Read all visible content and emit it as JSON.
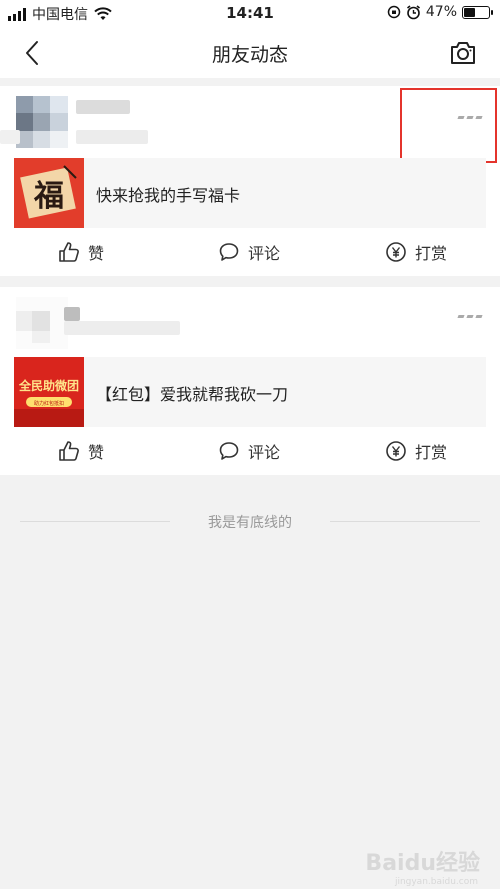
{
  "status_bar": {
    "carrier": "中国电信",
    "time": "14:41",
    "battery_percent": "47%",
    "battery_level": 0.47
  },
  "nav": {
    "title": "朋友动态",
    "back_icon": "chevron-left-icon",
    "camera_icon": "camera-icon"
  },
  "posts": [
    {
      "share_text": "快来抢我的手写福卡",
      "thumb_glyph": "福",
      "actions": {
        "like": "赞",
        "comment": "评论",
        "reward": "打赏"
      }
    },
    {
      "share_text": "【红包】爱我就帮我砍一刀",
      "thumb_title": "全民助微团",
      "thumb_sub": "助力红包抵扣",
      "actions": {
        "like": "赞",
        "comment": "评论",
        "reward": "打赏"
      }
    }
  ],
  "footer": {
    "text": "我是有底线的"
  },
  "watermark": {
    "text": "Baidu经验",
    "sub": "jingyan.baidu.com"
  },
  "colors": {
    "highlight": "#e4342c",
    "background": "#f2f2f2",
    "thumb_red": "#d9251d"
  }
}
